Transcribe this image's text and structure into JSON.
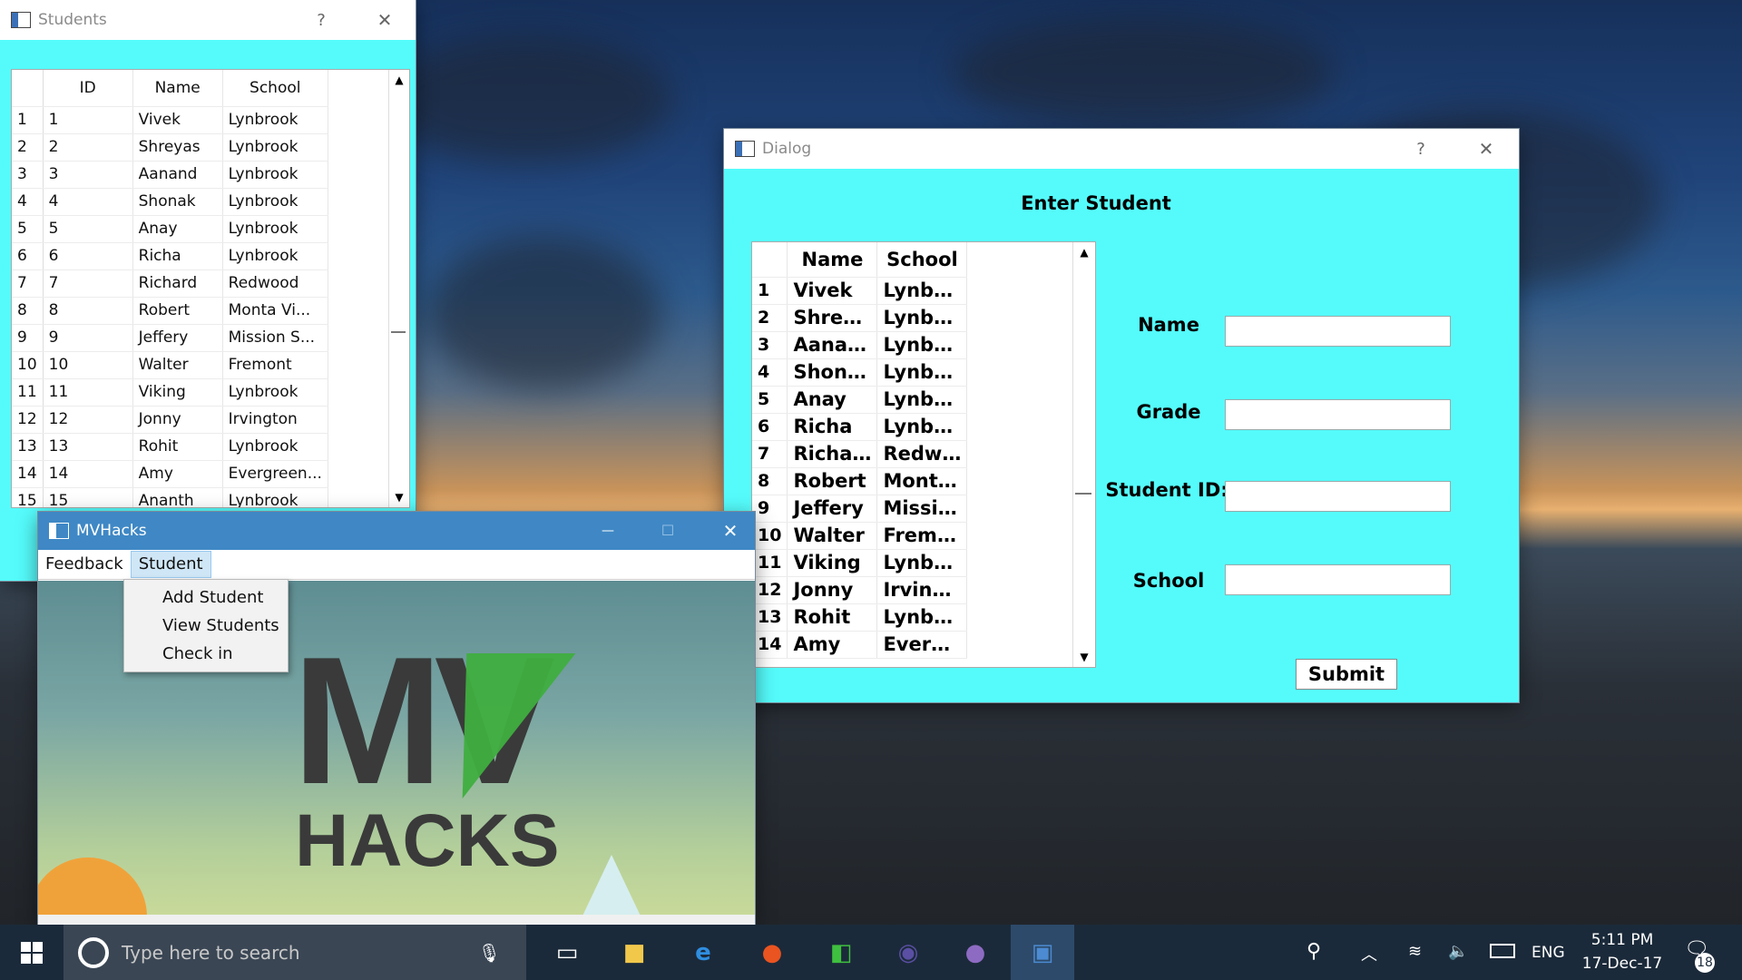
{
  "colors": {
    "cyan": "#55fbfb",
    "titlebar_blue": "#3f88c5",
    "dialog_title": "#8a8a8a"
  },
  "students_window": {
    "title": "Students",
    "help": "?",
    "close": "✕",
    "columns": [
      "ID",
      "Name",
      "School"
    ],
    "rows": [
      {
        "n": "1",
        "id": "1",
        "name": "Vivek",
        "school": "Lynbrook"
      },
      {
        "n": "2",
        "id": "2",
        "name": "Shreyas",
        "school": "Lynbrook"
      },
      {
        "n": "3",
        "id": "3",
        "name": "Aanand",
        "school": "Lynbrook"
      },
      {
        "n": "4",
        "id": "4",
        "name": "Shonak",
        "school": "Lynbrook"
      },
      {
        "n": "5",
        "id": "5",
        "name": "Anay",
        "school": "Lynbrook"
      },
      {
        "n": "6",
        "id": "6",
        "name": "Richa",
        "school": "Lynbrook"
      },
      {
        "n": "7",
        "id": "7",
        "name": "Richard",
        "school": "Redwood"
      },
      {
        "n": "8",
        "id": "8",
        "name": "Robert",
        "school": "Monta Vi..."
      },
      {
        "n": "9",
        "id": "9",
        "name": "Jeffery",
        "school": "Mission S..."
      },
      {
        "n": "10",
        "id": "10",
        "name": "Walter",
        "school": "Fremont"
      },
      {
        "n": "11",
        "id": "11",
        "name": "Viking",
        "school": "Lynbrook"
      },
      {
        "n": "12",
        "id": "12",
        "name": "Jonny",
        "school": "Irvington"
      },
      {
        "n": "13",
        "id": "13",
        "name": "Rohit",
        "school": "Lynbrook"
      },
      {
        "n": "14",
        "id": "14",
        "name": "Amy",
        "school": "Evergreen..."
      },
      {
        "n": "15",
        "id": "15",
        "name": "Ananth",
        "school": "Lynbrook"
      }
    ]
  },
  "dialog": {
    "title": "Dialog",
    "help": "?",
    "close": "✕",
    "heading": "Enter Student",
    "columns": [
      "Name",
      "School"
    ],
    "rows": [
      {
        "n": "1",
        "name": "Vivek",
        "school": "Lynbro..."
      },
      {
        "n": "2",
        "name": "Shreyas",
        "school": "Lynbro..."
      },
      {
        "n": "3",
        "name": "Aanand",
        "school": "Lynbro..."
      },
      {
        "n": "4",
        "name": "Shonak",
        "school": "Lynbro..."
      },
      {
        "n": "5",
        "name": "Anay",
        "school": "Lynbro..."
      },
      {
        "n": "6",
        "name": "Richa",
        "school": "Lynbro..."
      },
      {
        "n": "7",
        "name": "Richard",
        "school": "Redwo..."
      },
      {
        "n": "8",
        "name": "Robert",
        "school": "Monta ..."
      },
      {
        "n": "9",
        "name": "Jeffery",
        "school": "Mission ..."
      },
      {
        "n": "10",
        "name": "Walter",
        "school": "Fremont"
      },
      {
        "n": "11",
        "name": "Viking",
        "school": "Lynbro..."
      },
      {
        "n": "12",
        "name": "Jonny",
        "school": "Irvington"
      },
      {
        "n": "13",
        "name": "Rohit",
        "school": "Lynbro..."
      },
      {
        "n": "14",
        "name": "Amy",
        "school": "Evergr..."
      }
    ],
    "labels": {
      "name": "Name",
      "grade": "Grade",
      "student_id": "Student ID:",
      "school": "School"
    },
    "inputs": {
      "name": "",
      "grade": "",
      "student_id": "",
      "school": ""
    },
    "submit": "Submit"
  },
  "main_window": {
    "title": "MVHacks",
    "minimize": "—",
    "maximize": "☐",
    "close": "✕",
    "menu": [
      "Feedback",
      "Student"
    ],
    "dropdown": [
      "Add Student",
      "View Students",
      "Check in"
    ],
    "logo_top": "MV",
    "logo_bottom": "HACKS"
  },
  "taskbar": {
    "search_placeholder": "Type here to search",
    "time": "5:11 PM",
    "date": "17-Dec-17",
    "lang": "ENG",
    "notifications": "18"
  }
}
